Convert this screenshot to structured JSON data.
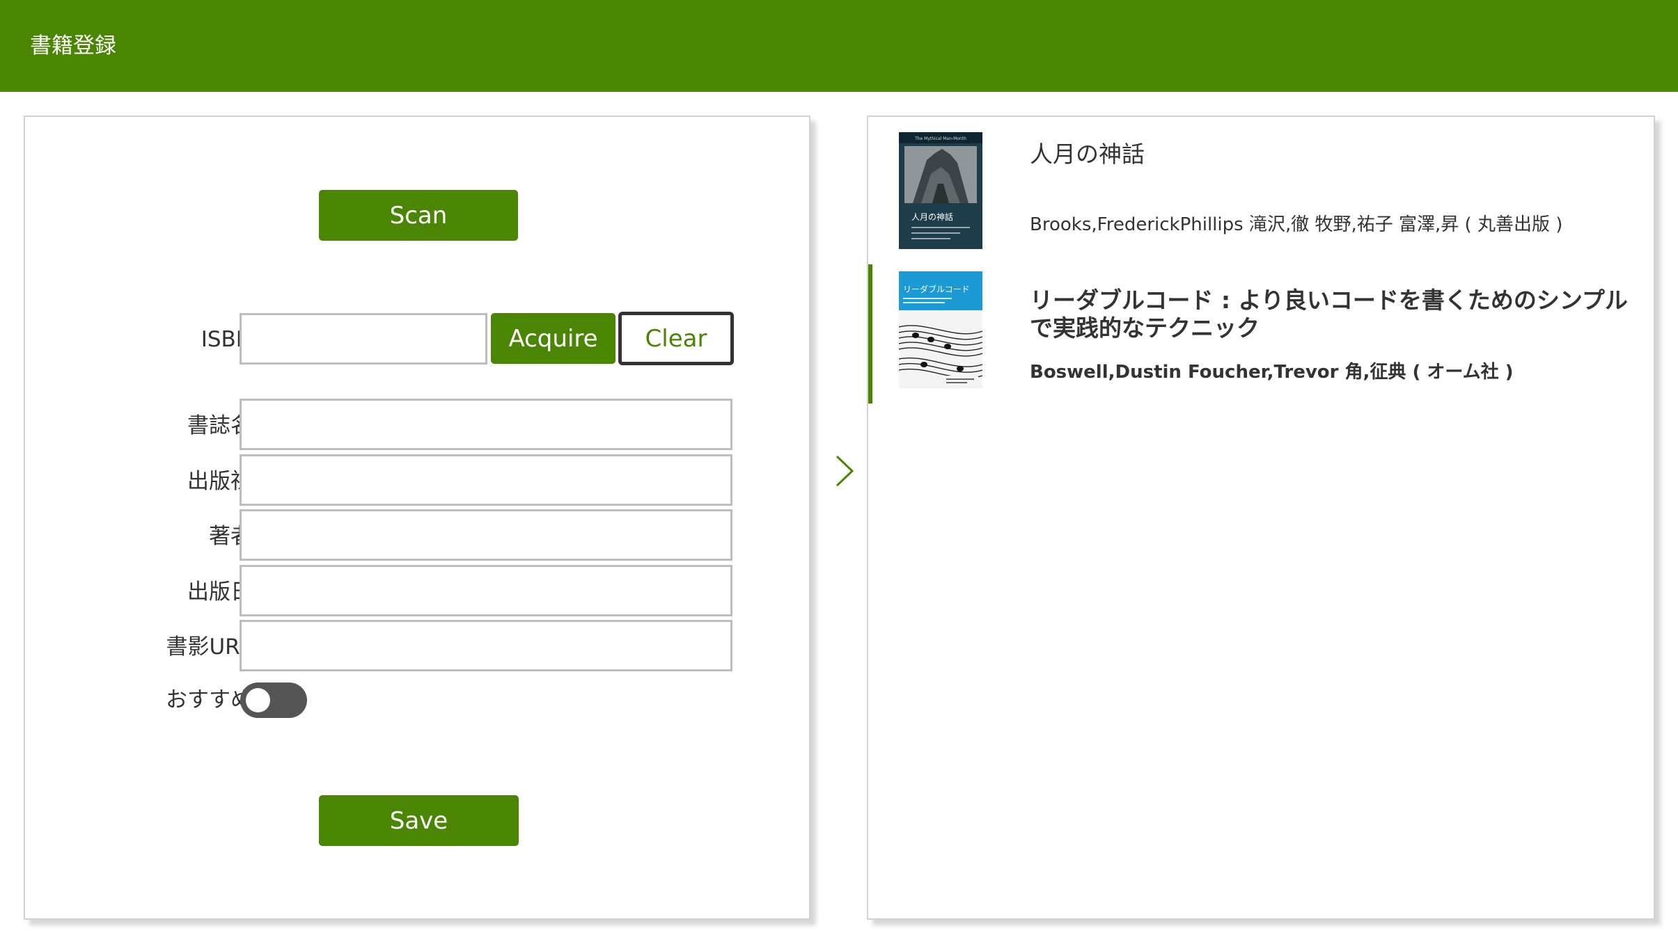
{
  "header": {
    "title": "書籍登録"
  },
  "form": {
    "scan_label": "Scan",
    "acquire_label": "Acquire",
    "clear_label": "Clear",
    "save_label": "Save",
    "isbn_label": "ISBN",
    "title_label": "書誌名",
    "publisher_label": "出版社",
    "author_label": "著者",
    "date_label": "出版日",
    "cover_url_label": "書影URL",
    "recommend_label": "おすすめ",
    "recommend_on": false,
    "isbn_value": "",
    "title_value": "",
    "publisher_value": "",
    "author_value": "",
    "date_value": "",
    "cover_url_value": ""
  },
  "books": [
    {
      "title": "人月の神話",
      "authors": "Brooks,FrederickPhillips 滝沢,徹 牧野,祐子 富澤,昇 ( 丸善出版 )",
      "cover_title": "人月の神話",
      "cover_top": "The Mythical Man-Month",
      "selected": false
    },
    {
      "title": "リーダブルコード : より良いコードを書くためのシンプルで実践的なテクニック",
      "authors": "Boswell,Dustin Foucher,Trevor 角,征典 ( オーム社 )",
      "cover_title": "リーダブルコード",
      "cover_sub": "より良いコードを書くためのシンプルで実践的なテクニック",
      "selected": true
    }
  ],
  "colors": {
    "accent": "#4a8504",
    "toggle_off": "#555555",
    "cover1": "#1d3d4a",
    "cover2": "#1b9ad6"
  }
}
